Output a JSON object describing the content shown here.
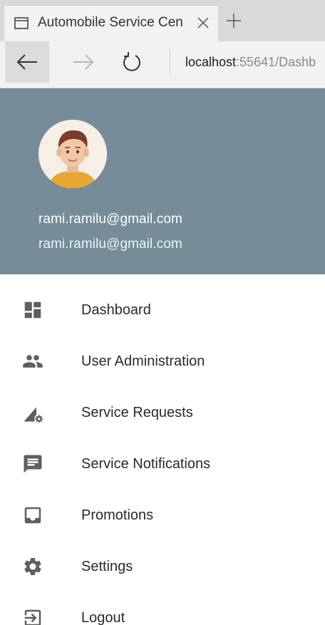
{
  "browser": {
    "tab_title": "Automobile Service Cen",
    "url_host": "localhost",
    "url_rest": ":55641/Dashb"
  },
  "drawer": {
    "user_name": "rami.ramilu@gmail.com",
    "user_email": "rami.ramilu@gmail.com",
    "header_color": "#768d99"
  },
  "menu": {
    "items": [
      {
        "label": "Dashboard",
        "icon": "dashboard-icon"
      },
      {
        "label": "User Administration",
        "icon": "people-icon"
      },
      {
        "label": "Service Requests",
        "icon": "signal-settings-icon"
      },
      {
        "label": "Service Notifications",
        "icon": "message-icon"
      },
      {
        "label": "Promotions",
        "icon": "inbox-icon"
      },
      {
        "label": "Settings",
        "icon": "gear-icon"
      },
      {
        "label": "Logout",
        "icon": "exit-icon"
      }
    ]
  }
}
